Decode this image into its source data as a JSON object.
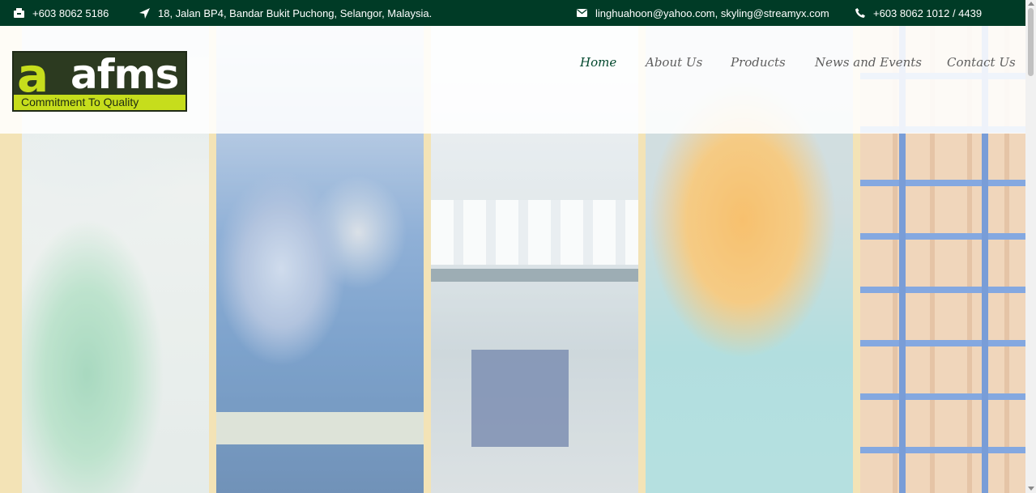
{
  "topbar": {
    "phone": "+603 8062 5186",
    "address": "18, Jalan BP4, Bandar Bukit Puchong, Selangor, Malaysia.",
    "email": "linghuahoon@yahoo.com, skyling@streamyx.com",
    "phone_alt": "+603 8062 1012 / 4439",
    "background_color": "#003b26"
  },
  "logo": {
    "wordmark": "afms",
    "tagline": "Commitment To Quality",
    "lime_color": "#c6dd1c"
  },
  "nav": {
    "items": [
      {
        "label": "Home",
        "active": true
      },
      {
        "label": "About Us",
        "active": false
      },
      {
        "label": "Products",
        "active": false
      },
      {
        "label": "News and Events",
        "active": false
      },
      {
        "label": "Contact Us",
        "active": false
      }
    ],
    "active_color": "#00472c"
  },
  "hero": {
    "panels": [
      "lab-gloves-photo",
      "microscope-photo",
      "bottling-line-photo",
      "orange-bottle-photo",
      "warehouse-shelves-photo"
    ]
  }
}
